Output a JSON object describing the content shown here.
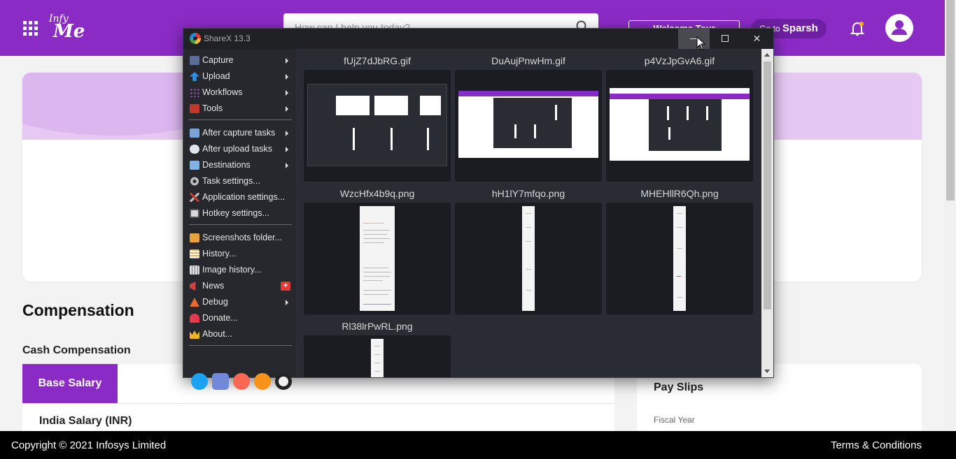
{
  "page": {
    "logo": {
      "line1": "Infy",
      "line2": "Me"
    },
    "search": {
      "placeholder": "How can I help you today?"
    },
    "welcome_label": "Welcome Tour",
    "sparsh": {
      "prefix": "Go to",
      "name": "Sparsh"
    },
    "section_title": "Compensation",
    "cash_title": "Cash Compensation",
    "base_salary_tab": "Base Salary",
    "india_salary": "India Salary (INR)",
    "payslips_title": "Pay Slips",
    "fiscal_year_label": "Fiscal Year",
    "footer": {
      "copyright": "Copyright © 2021 Infosys Limited",
      "terms": "Terms & Conditions"
    },
    "colors": {
      "brand": "#8b2bc6",
      "brand_light": "#e6c9f3"
    }
  },
  "sharex": {
    "title": "ShareX 13.3",
    "menu": [
      {
        "label": "Capture",
        "icon": "capture-icon",
        "submenu": true
      },
      {
        "label": "Upload",
        "icon": "upload-icon",
        "submenu": true
      },
      {
        "label": "Workflows",
        "icon": "workflows-icon",
        "submenu": true
      },
      {
        "label": "Tools",
        "icon": "tools-icon",
        "submenu": true
      },
      {
        "label": "After capture tasks",
        "icon": "after-capture-icon",
        "submenu": true
      },
      {
        "label": "After upload tasks",
        "icon": "after-upload-icon",
        "submenu": true
      },
      {
        "label": "Destinations",
        "icon": "destinations-icon",
        "submenu": true
      },
      {
        "label": "Task settings...",
        "icon": "gear-icon",
        "submenu": false
      },
      {
        "label": "Application settings...",
        "icon": "wrench-icon",
        "submenu": false
      },
      {
        "label": "Hotkey settings...",
        "icon": "keyboard-icon",
        "submenu": false
      },
      {
        "label": "Screenshots folder...",
        "icon": "folder-icon",
        "submenu": false
      },
      {
        "label": "History...",
        "icon": "history-icon",
        "submenu": false
      },
      {
        "label": "Image history...",
        "icon": "image-history-icon",
        "submenu": false
      },
      {
        "label": "News",
        "icon": "megaphone-icon",
        "submenu": false,
        "badge": "+"
      },
      {
        "label": "Debug",
        "icon": "debug-icon",
        "submenu": true
      },
      {
        "label": "Donate...",
        "icon": "heart-icon",
        "submenu": false
      },
      {
        "label": "About...",
        "icon": "crown-icon",
        "submenu": false
      }
    ],
    "social": [
      "twitter-icon",
      "discord-icon",
      "patreon-icon",
      "bitcoin-icon",
      "github-icon"
    ],
    "files": [
      {
        "name": "fUjZ7dJbRG.gif",
        "kind": "sharex-shot"
      },
      {
        "name": "DuAujPnwHm.gif",
        "kind": "page-shot"
      },
      {
        "name": "p4VzJpGvA6.gif",
        "kind": "browser-shot"
      },
      {
        "name": "WzcHfx4b9q.png",
        "kind": "document"
      },
      {
        "name": "hH1lY7mfqo.png",
        "kind": "slim-document"
      },
      {
        "name": "MHEHllR6Qh.png",
        "kind": "slim-document"
      },
      {
        "name": "Rl38lrPwRL.png",
        "kind": "slim-document"
      }
    ]
  }
}
